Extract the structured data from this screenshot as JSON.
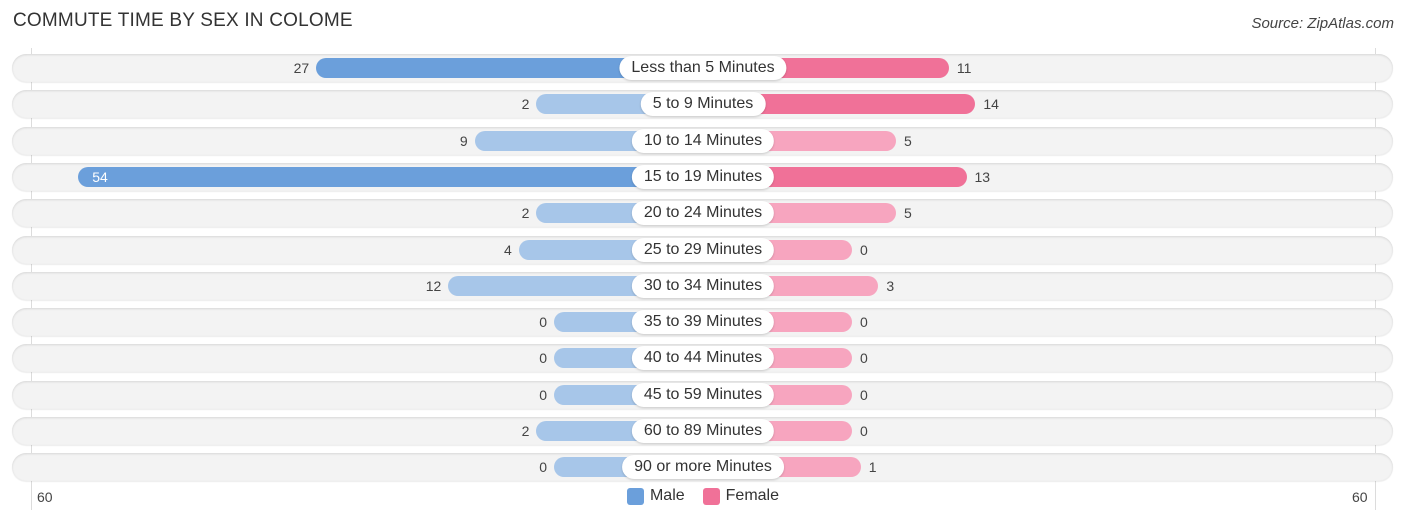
{
  "header": {
    "title": "COMMUTE TIME BY SEX IN COLOME",
    "source": "Source: ZipAtlas.com"
  },
  "colors": {
    "male": "#6b9fdb",
    "male_light": "#a7c6e9",
    "female": "#f07198",
    "female_light": "#f7a5bf"
  },
  "chart_data": {
    "type": "bar",
    "orientation": "horizontal-diverging",
    "title": "COMMUTE TIME BY SEX IN COLOME",
    "categories": [
      "Less than 5 Minutes",
      "5 to 9 Minutes",
      "10 to 14 Minutes",
      "15 to 19 Minutes",
      "20 to 24 Minutes",
      "25 to 29 Minutes",
      "30 to 34 Minutes",
      "35 to 39 Minutes",
      "40 to 44 Minutes",
      "45 to 59 Minutes",
      "60 to 89 Minutes",
      "90 or more Minutes"
    ],
    "series": [
      {
        "name": "Male",
        "values": [
          27,
          2,
          9,
          54,
          2,
          4,
          12,
          0,
          0,
          0,
          2,
          0
        ]
      },
      {
        "name": "Female",
        "values": [
          11,
          14,
          5,
          13,
          5,
          0,
          3,
          0,
          0,
          0,
          0,
          1
        ]
      }
    ],
    "axis": {
      "left_label": "60",
      "right_label": "60",
      "max": 60
    },
    "legend": {
      "position": "bottom-center",
      "items": [
        "Male",
        "Female"
      ]
    }
  }
}
